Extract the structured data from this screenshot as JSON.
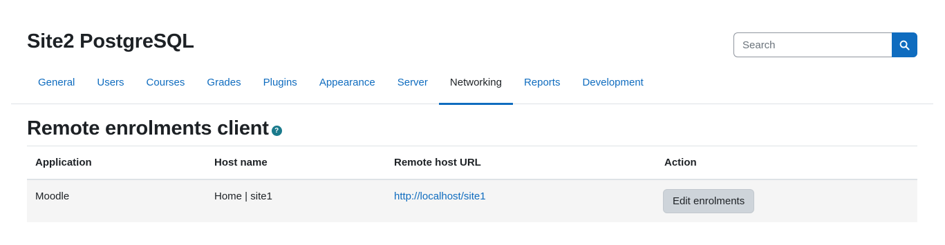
{
  "header": {
    "site_title": "Site2 PostgreSQL",
    "search_placeholder": "Search",
    "search_icon": "magnifier-icon"
  },
  "nav": {
    "tabs": [
      {
        "label": "General",
        "active": false
      },
      {
        "label": "Users",
        "active": false
      },
      {
        "label": "Courses",
        "active": false
      },
      {
        "label": "Grades",
        "active": false
      },
      {
        "label": "Plugins",
        "active": false
      },
      {
        "label": "Appearance",
        "active": false
      },
      {
        "label": "Server",
        "active": false
      },
      {
        "label": "Networking",
        "active": true
      },
      {
        "label": "Reports",
        "active": false
      },
      {
        "label": "Development",
        "active": false
      }
    ]
  },
  "main": {
    "heading": "Remote enrolments client",
    "help_icon": "question-circle-icon",
    "help_glyph": "?",
    "table": {
      "columns": [
        "Application",
        "Host name",
        "Remote host URL",
        "Action"
      ],
      "rows": [
        {
          "application": "Moodle",
          "host_name": "Home | site1",
          "remote_host_url": "http://localhost/site1",
          "action": "Edit enrolments"
        }
      ]
    }
  },
  "colors": {
    "accent": "#0f6cbf",
    "help": "#1a7a8c",
    "row_bg": "#f5f5f5",
    "button_bg": "#ced4da"
  }
}
